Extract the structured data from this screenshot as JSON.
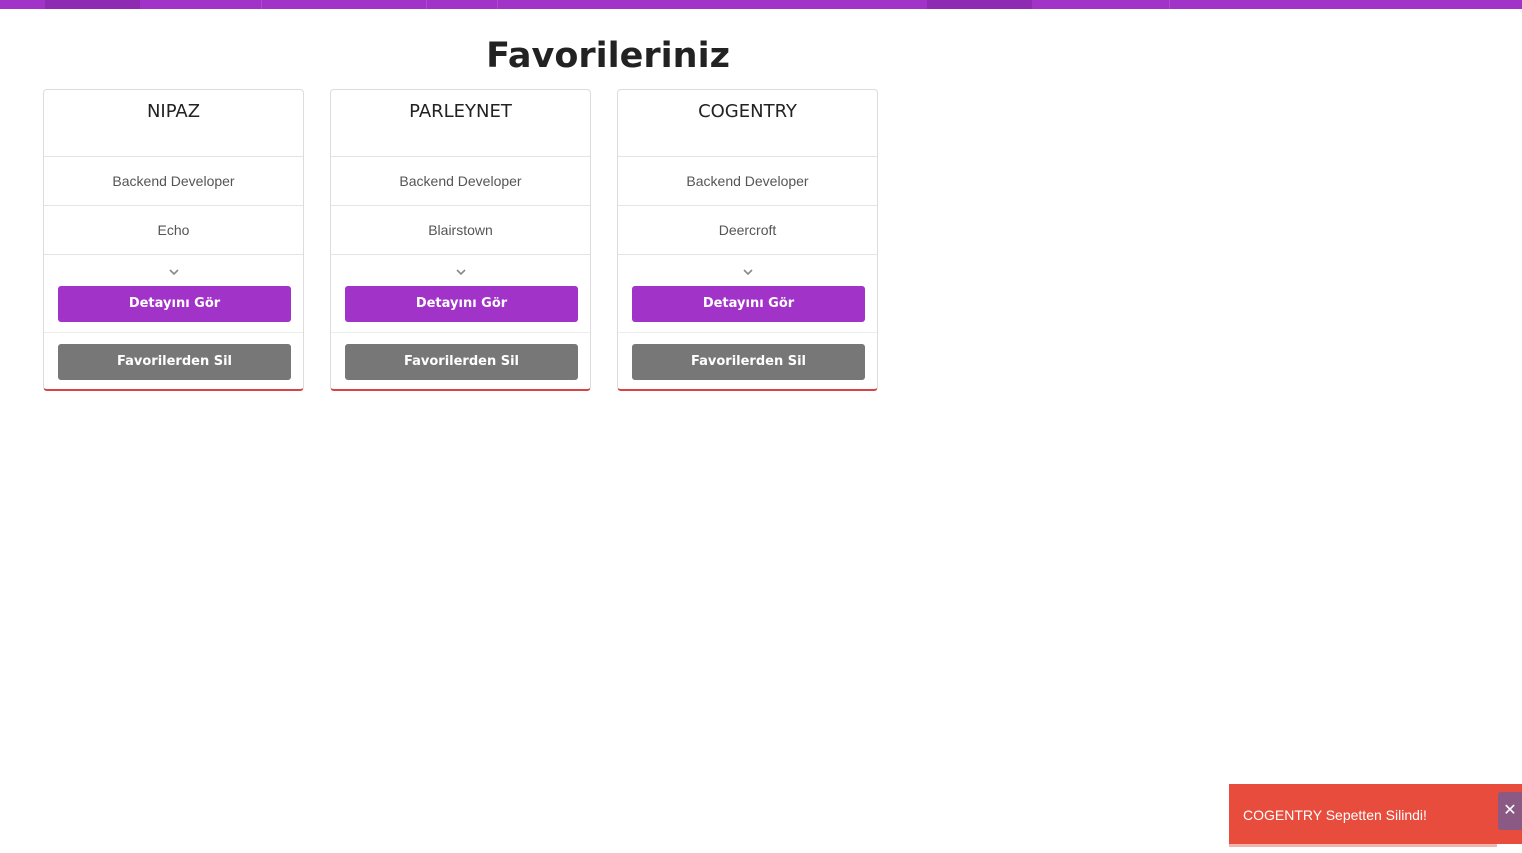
{
  "page": {
    "title": "Favorileriniz"
  },
  "cards": [
    {
      "company": "NIPAZ",
      "position": "Backend Developer",
      "city": "Echo",
      "detail_label": "Detayını Gör",
      "remove_label": "Favorilerden Sil"
    },
    {
      "company": "PARLEYNET",
      "position": "Backend Developer",
      "city": "Blairstown",
      "detail_label": "Detayını Gör",
      "remove_label": "Favorilerden Sil"
    },
    {
      "company": "COGENTRY",
      "position": "Backend Developer",
      "city": "Deercroft",
      "detail_label": "Detayını Gör",
      "remove_label": "Favorilerden Sil"
    }
  ],
  "toast": {
    "message": "COGENTRY Sepetten Silindi!",
    "close_glyph": "✕",
    "icon": "close-icon"
  },
  "icons": {
    "expand": "chevron-down-icon"
  },
  "colors": {
    "accent": "#a233c9",
    "remove_button": "#777777",
    "toast_bg": "#e74c3c",
    "card_bottom_border": "#d64545"
  }
}
